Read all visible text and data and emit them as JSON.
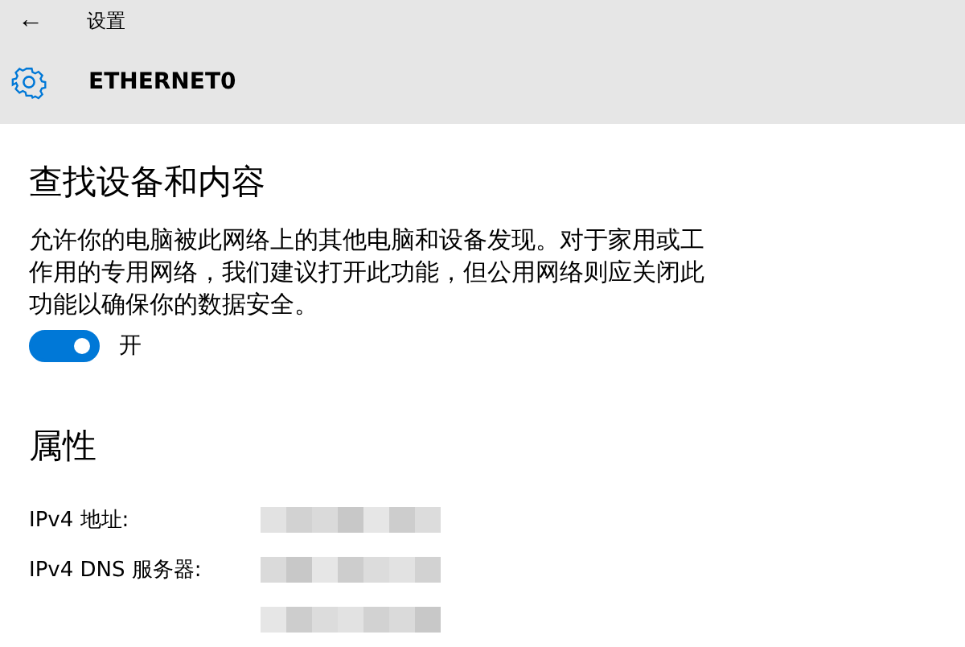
{
  "header": {
    "back_glyph": "←",
    "title": "设置",
    "page_title": "ETHERNET0"
  },
  "discovery": {
    "heading": "查找设备和内容",
    "description": "允许你的电脑被此网络上的其他电脑和设备发现。对于家用或工作用的专用网络，我们建议打开此功能，但公用网络则应关闭此功能以确保你的数据安全。",
    "toggle": {
      "on": true,
      "label": "开"
    }
  },
  "properties": {
    "heading": "属性",
    "rows": [
      {
        "label": "IPv4 地址:",
        "kind": "redacted"
      },
      {
        "label": "IPv4 DNS 服务器:",
        "kind": "redacted"
      },
      {
        "kind": "redacted"
      }
    ]
  }
}
